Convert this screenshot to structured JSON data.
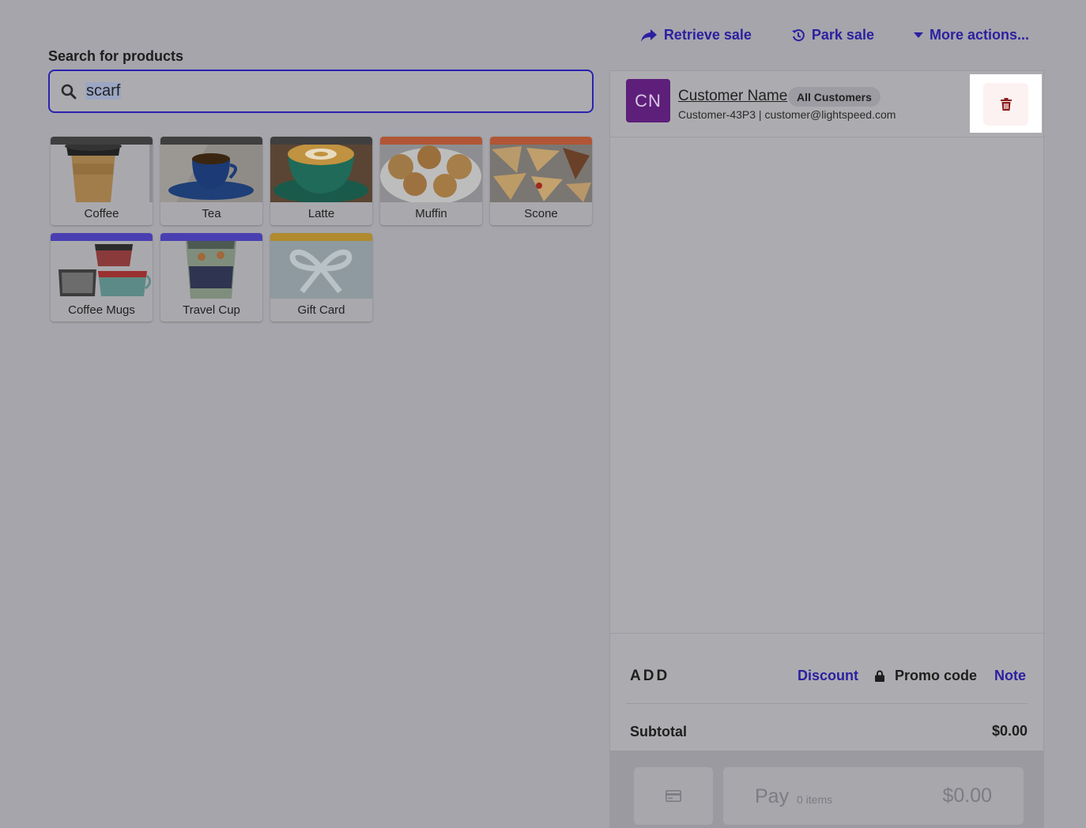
{
  "top_actions": {
    "retrieve_sale": "Retrieve sale",
    "park_sale": "Park sale",
    "more_actions": "More actions..."
  },
  "search": {
    "label": "Search for products",
    "value": "scarf",
    "icon": "search-icon"
  },
  "products": [
    {
      "name": "Coffee",
      "color": "#3f3f3f"
    },
    {
      "name": "Tea",
      "color": "#3f3f3f"
    },
    {
      "name": "Latte",
      "color": "#3f3f3f"
    },
    {
      "name": "Muffin",
      "color": "#b05636"
    },
    {
      "name": "Scone",
      "color": "#b05636"
    },
    {
      "name": "Coffee Mugs",
      "color": "#4a3fb2"
    },
    {
      "name": "Travel Cup",
      "color": "#4a3fb2"
    },
    {
      "name": "Gift Card",
      "color": "#b08a2e"
    }
  ],
  "customer": {
    "initials": "CN",
    "name": "Customer Name",
    "group": "All Customers",
    "meta": "Customer-43P3 | customer@lightspeed.com",
    "avatar_color": "#5e1f7a"
  },
  "add": {
    "label": "ADD",
    "discount": "Discount",
    "promo_code": "Promo code",
    "note": "Note"
  },
  "subtotal": {
    "label": "Subtotal",
    "value": "$0.00"
  },
  "pay": {
    "label": "Pay",
    "items": "0 items",
    "total": "$0.00"
  },
  "colors": {
    "accent": "#2c1fa0",
    "overlay_bg": "#a5a5ab",
    "delete": "#8b1a1a"
  }
}
